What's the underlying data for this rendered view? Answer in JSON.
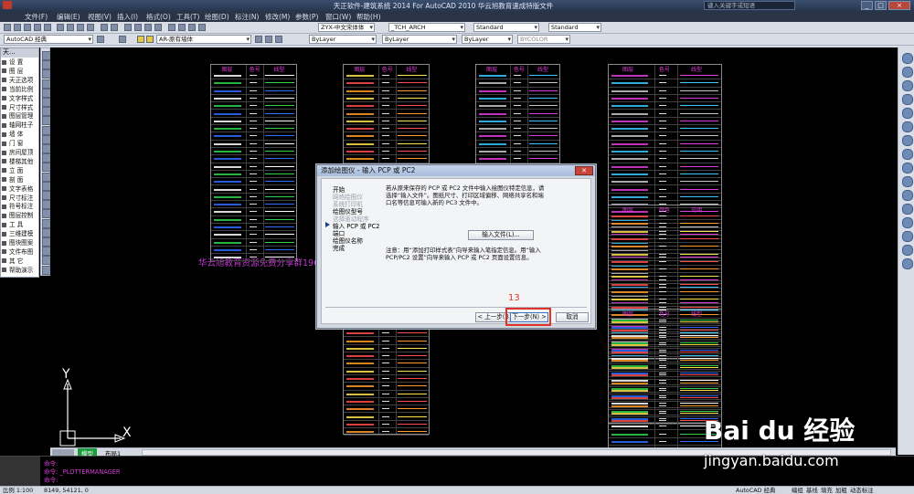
{
  "window": {
    "title": "天正软件-建筑系统 2014  For AutoCAD 2010      华云旭教育速成特版文件",
    "help_placeholder": "键入关键字或短语",
    "controls": [
      "_",
      "□",
      "×"
    ]
  },
  "menubar": [
    "文件(F)",
    "编辑(E)",
    "视图(V)",
    "插入(I)",
    "格式(O)",
    "工具(T)",
    "绘图(D)",
    "标注(N)",
    "修改(M)",
    "参数(P)",
    "窗口(W)",
    "帮助(H)"
  ],
  "toolbar1": {
    "text_style": "ZYX-中文宋体体",
    "arch_style": "_TCH_ARCH",
    "standard1": "Standard",
    "standard2": "Standard"
  },
  "toolbar2": {
    "workspace": "AutoCAD 经典",
    "layer": "AR-原有墙体",
    "color": "ByLayer",
    "linetype": "ByLayer",
    "lineweight": "ByLayer",
    "plotstyle": "BYCOLOR"
  },
  "left_palette": {
    "header": "天...",
    "items": [
      "设 置",
      "图 层",
      "天正选项",
      "当前比例",
      "文字样式",
      "尺寸样式",
      "图层管理",
      "轴网柱子",
      "墙 体",
      "门 窗",
      "房间屋顶",
      "楼梯其他",
      "立 面",
      "剖 面",
      "文字表格",
      "尺寸标注",
      "符号标注",
      "图层控制",
      "工 具",
      "三维建模",
      "图块图案",
      "文件布图",
      "其 它",
      "帮助演示"
    ]
  },
  "canvas": {
    "watermark": "华云旭教育资源免费分享群1962",
    "axis_x": "X",
    "axis_y": "Y",
    "table_header": [
      "图层",
      "色号",
      "线型"
    ],
    "table_header_right": [
      "图层",
      "颜色",
      "说明"
    ]
  },
  "dialog": {
    "title": "添加绘图仪 - 输入 PCP 或 PC2",
    "close": "✕",
    "steps": [
      {
        "label": "开始",
        "active": false,
        "dim": false
      },
      {
        "label": "网络绘图仪",
        "active": false,
        "dim": true
      },
      {
        "label": "系统打印机",
        "active": false,
        "dim": true
      },
      {
        "label": "绘图仪型号",
        "active": false,
        "dim": false
      },
      {
        "label": "选择驱动程序",
        "active": false,
        "dim": true
      },
      {
        "label": "输入 PCP 或 PC2",
        "active": true,
        "dim": false
      },
      {
        "label": "端口",
        "active": false,
        "dim": false
      },
      {
        "label": "绘图仪名称",
        "active": false,
        "dim": false
      },
      {
        "label": "完成",
        "active": false,
        "dim": false
      }
    ],
    "text1": "若从原来保存的 PCP 或 PC2 文件中输入绘图仪特定信息，请选择“输入文件”。图纸尺寸、打印区域偏移、网络共享名和端口名等信息可输入新的 PC3 文件中。",
    "import_button": "输入文件(L)...",
    "text2": "注意：用“添加打印样式表”向导来输入笔指定信息。用“输入 PCP/PC2 设置”向导来输入 PCP 或 PC2 页面设置信息。",
    "back_button": "< 上一步(B)",
    "next_button": "下一步(N) >",
    "cancel_button": "取消",
    "annotation": "13"
  },
  "tabs": {
    "model": "模型",
    "layout": "布局1"
  },
  "command": {
    "line1": "命令:",
    "line2": "命令: _PLOTTERMANAGER",
    "line3": "命令:"
  },
  "status": {
    "scale": "比例 1:100",
    "coords": "8149, 54121, 0",
    "workspace": "AutoCAD 经典",
    "items": [
      "编组",
      "基线",
      "填充",
      "加粗",
      "动态标注"
    ]
  },
  "brand": {
    "logo": "Bai du 经验",
    "url": "jingyan.baidu.com"
  }
}
